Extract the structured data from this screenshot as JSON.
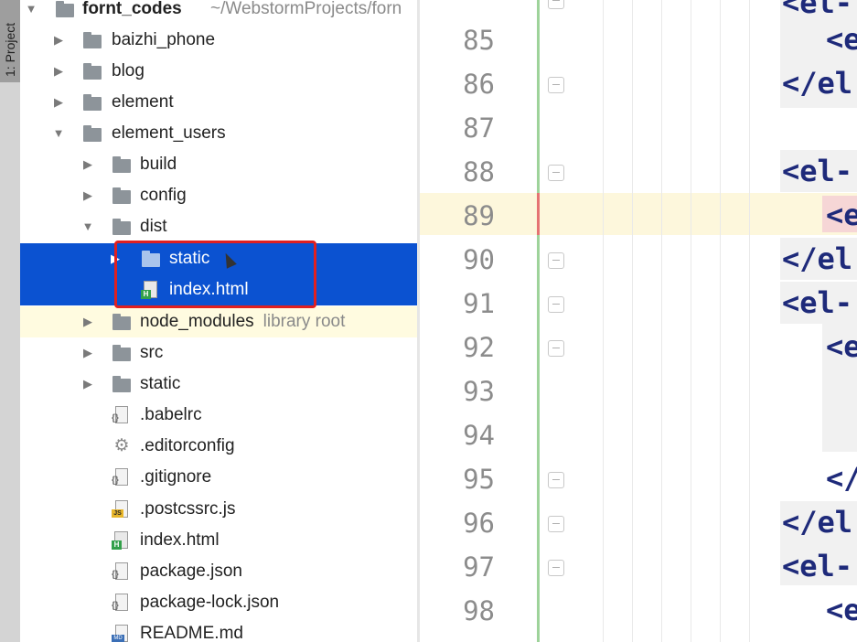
{
  "toolwindow": {
    "label": "1: Project"
  },
  "tree": {
    "root": {
      "name": "fornt_codes",
      "path": "~/WebstormProjects/forn"
    },
    "items": [
      {
        "label": "baizhi_phone"
      },
      {
        "label": "blog"
      },
      {
        "label": "element"
      },
      {
        "label": "element_users"
      },
      {
        "label": "build"
      },
      {
        "label": "config"
      },
      {
        "label": "dist"
      },
      {
        "label": "static"
      },
      {
        "label": "index.html"
      },
      {
        "label": "node_modules",
        "note": "library root"
      },
      {
        "label": "src"
      },
      {
        "label": "static"
      },
      {
        "label": ".babelrc"
      },
      {
        "label": ".editorconfig"
      },
      {
        "label": ".gitignore"
      },
      {
        "label": ".postcssrc.js"
      },
      {
        "label": "index.html"
      },
      {
        "label": "package.json"
      },
      {
        "label": "package-lock.json"
      },
      {
        "label": "README.md"
      }
    ]
  },
  "editor": {
    "line_numbers": [
      "85",
      "86",
      "87",
      "88",
      "89",
      "90",
      "91",
      "92",
      "93",
      "94",
      "95",
      "96",
      "97",
      "98"
    ],
    "code": {
      "top": "<el-",
      "l85": "<e",
      "l86": "</el",
      "l88": "<el-",
      "l89": "<e",
      "l90": "</el",
      "l91": "<el-",
      "l92": "<e",
      "l95": "</",
      "l96": "</el",
      "l97": "<el-",
      "l98": "<e"
    },
    "current_line": "89"
  },
  "colors": {
    "selection": "#0b52d1",
    "highlight_box": "#e02020",
    "current_line": "#fdf7dc"
  }
}
